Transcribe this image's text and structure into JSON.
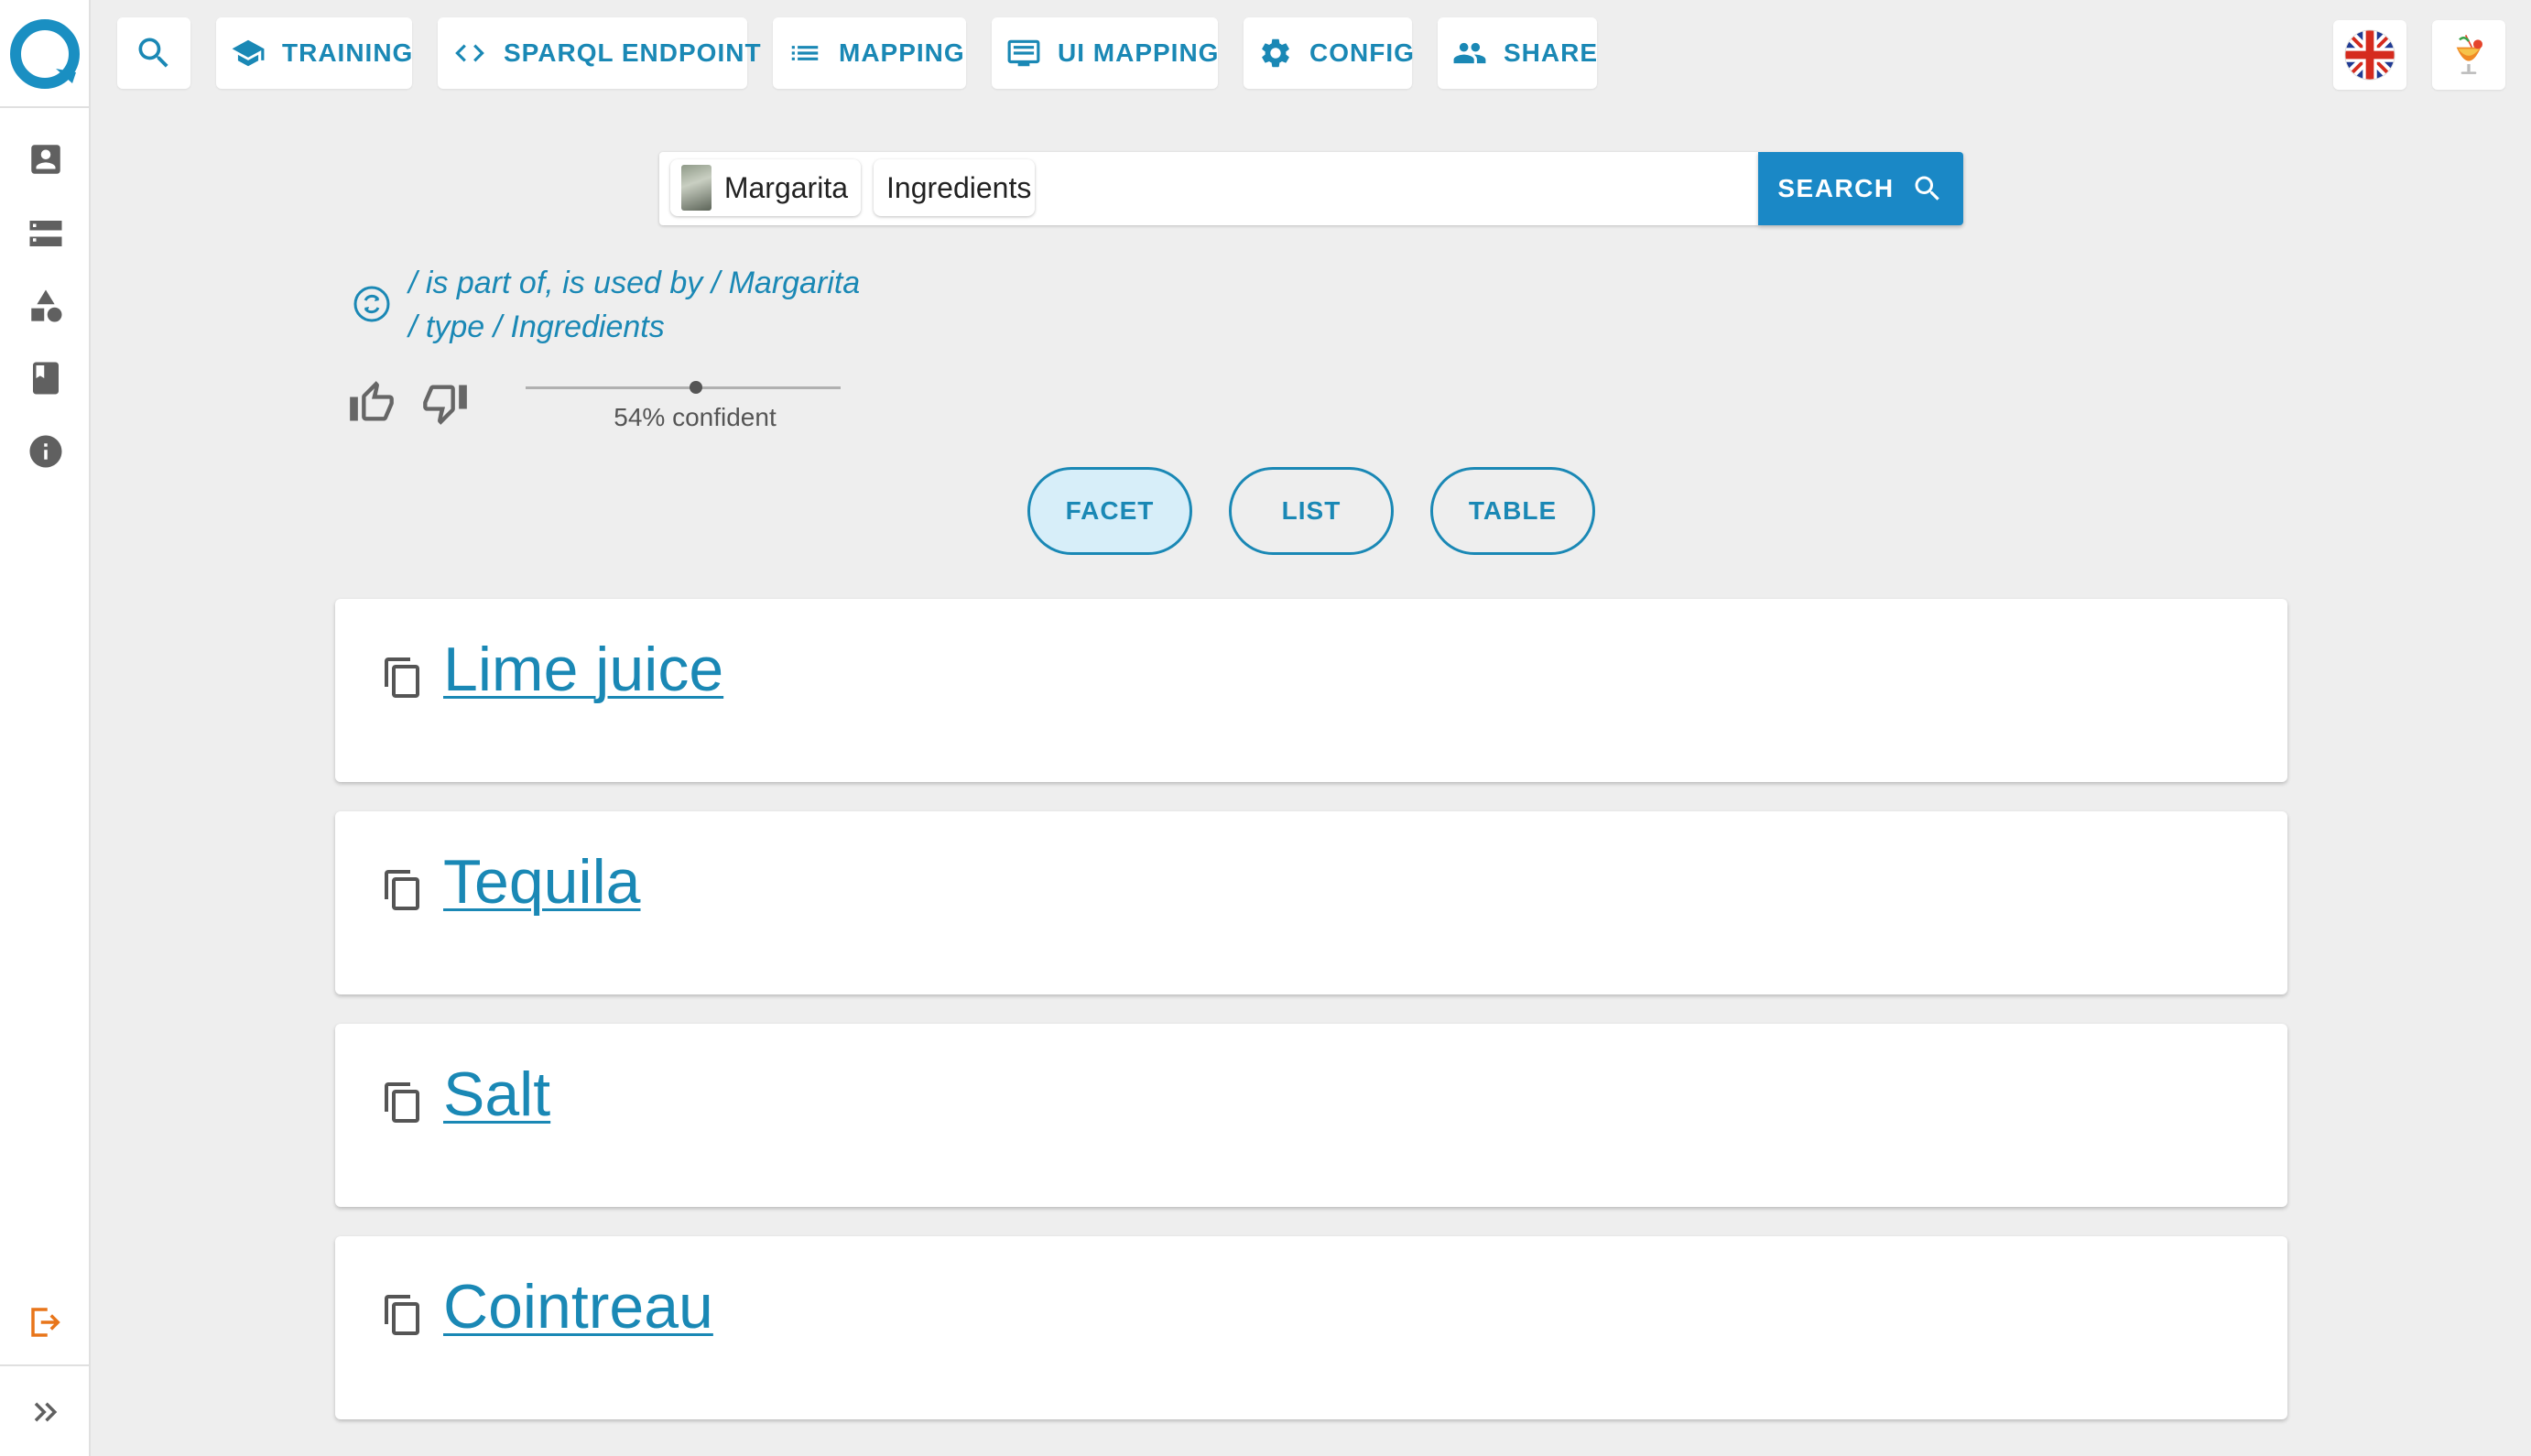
{
  "nav": {
    "training": "TRAINING",
    "sparql": "SPARQL ENDPOINT",
    "mapping": "MAPPING",
    "ui_mapping": "UI MAPPING",
    "config": "CONFIG",
    "share": "SHARE"
  },
  "search": {
    "chips": [
      "Margarita",
      "Ingredients"
    ],
    "button_label": "SEARCH"
  },
  "interpretation": {
    "line1": "/ is part of, is used by / Margarita",
    "line2": "/ type / Ingredients",
    "confidence_label": "54% confident",
    "confidence": 0.54
  },
  "views": {
    "facet": "FACET",
    "list": "LIST",
    "table": "TABLE",
    "active": "facet"
  },
  "results": [
    {
      "label": "Lime juice"
    },
    {
      "label": "Tequila"
    },
    {
      "label": "Salt"
    },
    {
      "label": "Cointreau"
    }
  ],
  "colors": {
    "accent": "#1a88b5",
    "search_button": "#1a88c6",
    "logout": "#e8751a",
    "background": "#eeeeee"
  }
}
